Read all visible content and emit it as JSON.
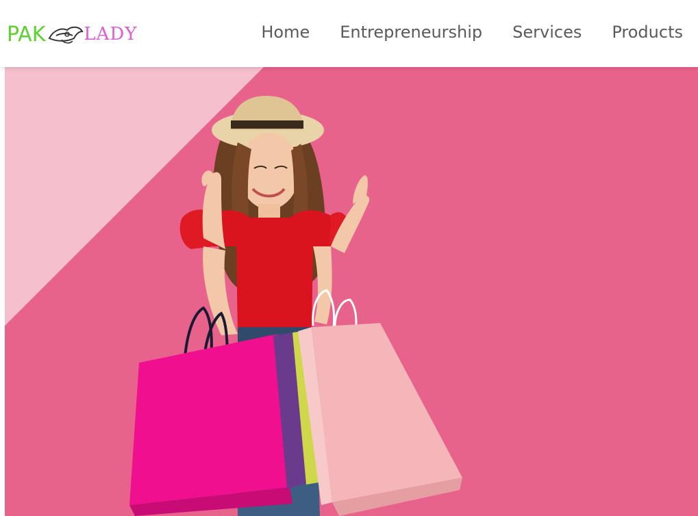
{
  "header": {
    "logo": {
      "text_left": "PAK",
      "text_right": "LADY",
      "mark_icon": "hat-icon",
      "colors": {
        "left": "#5cd12f",
        "right": "#e05bd3"
      }
    },
    "nav": [
      {
        "label": "Home"
      },
      {
        "label": "Entrepreneurship"
      },
      {
        "label": "Services"
      },
      {
        "label": "Products"
      }
    ]
  },
  "hero": {
    "background_color": "#e8638c",
    "accent_triangle_color": "#f5bfcd",
    "image_subject": "shopping-woman-illustration"
  }
}
